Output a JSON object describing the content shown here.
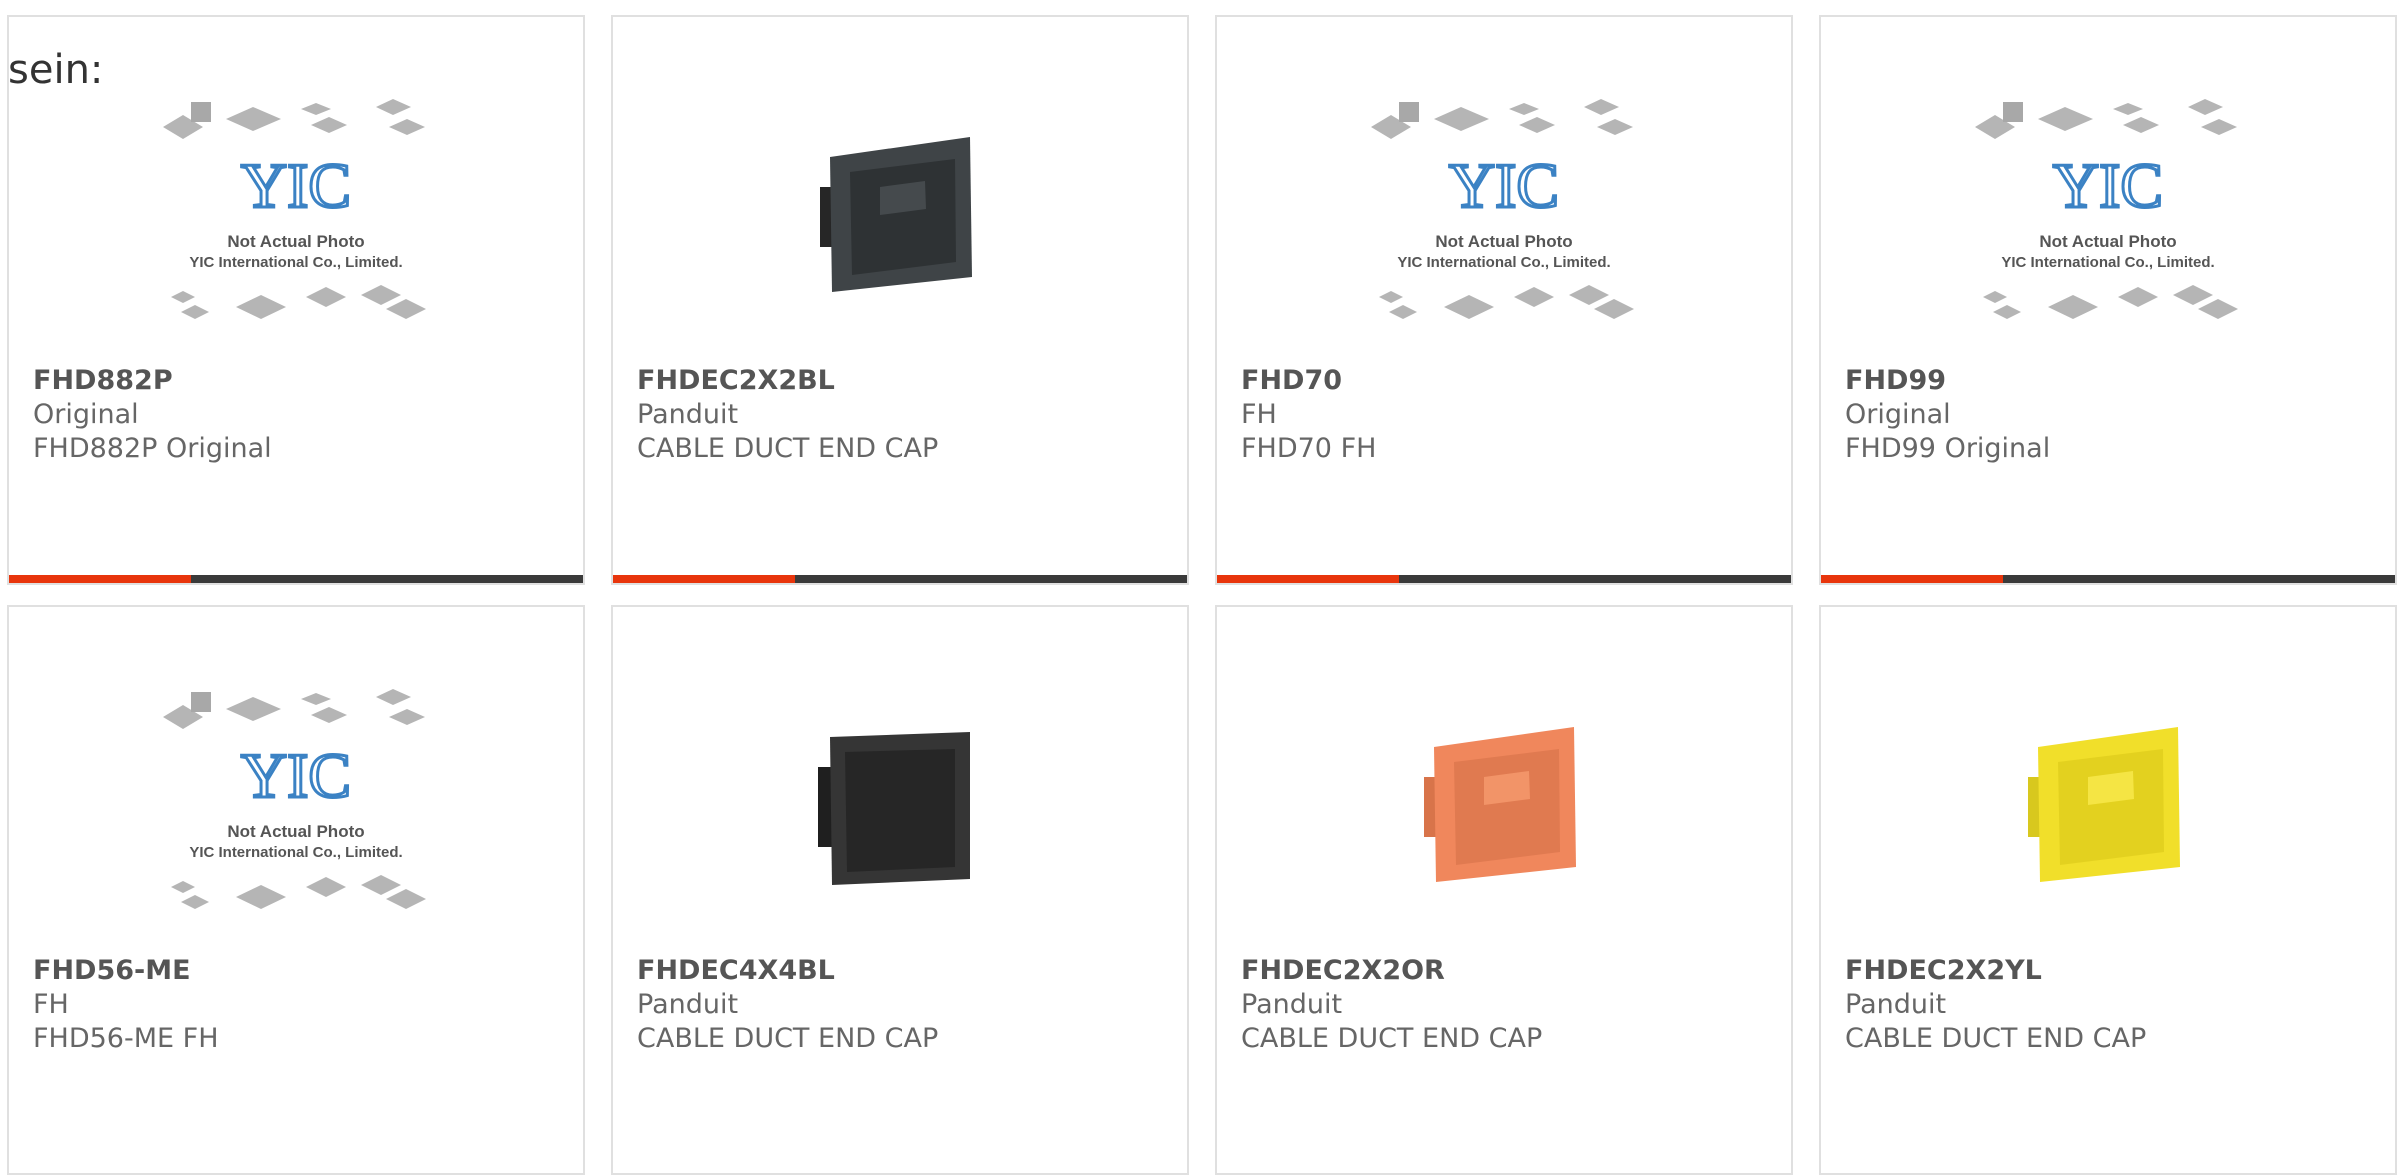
{
  "intro_text": "sein:",
  "colors": {
    "accent": "#e8350c",
    "bar": "#3a3a3a",
    "border": "#e0e0e0"
  },
  "placeholder": {
    "logo": "YIC",
    "line1": "Not Actual Photo",
    "line2": "YIC International Co., Limited."
  },
  "products": [
    {
      "name": "FHD882P",
      "brand": "Original",
      "desc": "FHD882P Original",
      "image": "placeholder-photo"
    },
    {
      "name": "FHDEC2X2BL",
      "brand": "Panduit",
      "desc": "CABLE DUCT END CAP",
      "image": "end-cap-black"
    },
    {
      "name": "FHD70",
      "brand": "FH",
      "desc": "FHD70 FH",
      "image": "placeholder-photo"
    },
    {
      "name": "FHD99",
      "brand": "Original",
      "desc": "FHD99 Original",
      "image": "placeholder-photo"
    },
    {
      "name": "FHD56-ME",
      "brand": "FH",
      "desc": "FHD56-ME FH",
      "image": "placeholder-photo"
    },
    {
      "name": "FHDEC4X4BL",
      "brand": "Panduit",
      "desc": "CABLE DUCT END CAP",
      "image": "end-cap-black-square"
    },
    {
      "name": "FHDEC2X2OR",
      "brand": "Panduit",
      "desc": "CABLE DUCT END CAP",
      "image": "end-cap-orange"
    },
    {
      "name": "FHDEC2X2YL",
      "brand": "Panduit",
      "desc": "CABLE DUCT END CAP",
      "image": "end-cap-yellow"
    }
  ]
}
